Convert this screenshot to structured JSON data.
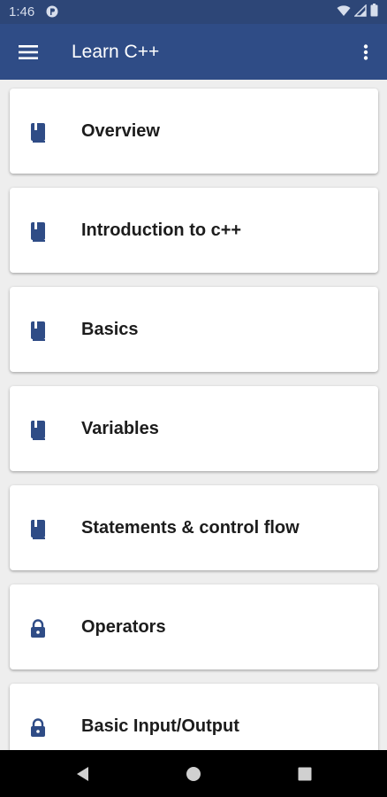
{
  "status_bar": {
    "time": "1:46"
  },
  "app_bar": {
    "title": "Learn C++",
    "menu_icon": "hamburger-menu-icon",
    "overflow_icon": "more-vert-icon"
  },
  "topics": [
    {
      "label": "Overview",
      "icon": "book-icon",
      "locked": false
    },
    {
      "label": "Introduction to c++",
      "icon": "book-icon",
      "locked": false
    },
    {
      "label": "Basics",
      "icon": "book-icon",
      "locked": false
    },
    {
      "label": "Variables",
      "icon": "book-icon",
      "locked": false
    },
    {
      "label": "Statements & control flow",
      "icon": "book-icon",
      "locked": false
    },
    {
      "label": "Operators",
      "icon": "lock-icon",
      "locked": true
    },
    {
      "label": "Basic Input/Output",
      "icon": "lock-icon",
      "locked": true
    }
  ],
  "nav_bar": {
    "buttons": [
      "back-icon",
      "home-icon",
      "recents-icon"
    ]
  },
  "colors": {
    "status_bar": "#2d4677",
    "app_bar": "#2f4c86",
    "icon": "#2f4c86",
    "background": "#eeeeee",
    "card": "#ffffff",
    "nav_bar": "#000000"
  }
}
